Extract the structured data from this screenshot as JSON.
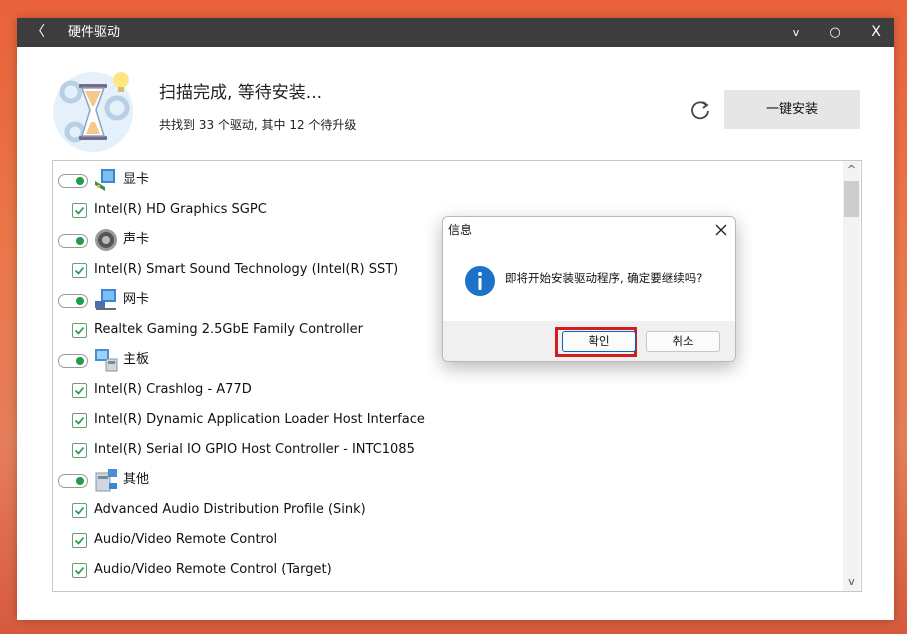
{
  "window": {
    "back_label": "〈",
    "title": "硬件驱动",
    "minimize_label": "v",
    "maximize_label": "○",
    "close_label": "X"
  },
  "header": {
    "status_title": "扫描完成, 等待安装...",
    "status_detail": "共找到 33 个驱动, 其中 12 个待升级",
    "install_button": "一键安装"
  },
  "driver_list": {
    "rows": [
      {
        "type": "category",
        "label": "显卡",
        "icon": "display-card-icon",
        "enabled": true
      },
      {
        "type": "driver",
        "label": "Intel(R) HD Graphics SGPC",
        "checked": true
      },
      {
        "type": "category",
        "label": "声卡",
        "icon": "speaker-icon",
        "enabled": true
      },
      {
        "type": "driver",
        "label": "Intel(R) Smart Sound Technology (Intel(R) SST)",
        "checked": true
      },
      {
        "type": "category",
        "label": "网卡",
        "icon": "network-icon",
        "enabled": true
      },
      {
        "type": "driver",
        "label": "Realtek Gaming 2.5GbE Family Controller",
        "checked": true
      },
      {
        "type": "category",
        "label": "主板",
        "icon": "motherboard-icon",
        "enabled": true
      },
      {
        "type": "driver",
        "label": "Intel(R) Crashlog - A77D",
        "checked": true
      },
      {
        "type": "driver",
        "label": "Intel(R) Dynamic Application Loader Host Interface",
        "checked": true
      },
      {
        "type": "driver",
        "label": "Intel(R) Serial IO GPIO Host Controller - INTC1085",
        "checked": true
      },
      {
        "type": "category",
        "label": "其他",
        "icon": "other-device-icon",
        "enabled": true
      },
      {
        "type": "driver",
        "label": "Advanced Audio Distribution Profile (Sink)",
        "checked": true
      },
      {
        "type": "driver",
        "label": "Audio/Video Remote Control",
        "checked": true
      },
      {
        "type": "driver",
        "label": "Audio/Video Remote Control (Target)",
        "checked": true
      }
    ],
    "scroll_up": "^",
    "scroll_down": "v"
  },
  "dialog": {
    "title": "信息",
    "message": "即将开始安装驱动程序, 确定要继续吗?",
    "ok_button": "확인",
    "cancel_button": "취소",
    "icon": "info-icon",
    "highlight_color": "#d61d1d"
  },
  "colors": {
    "titlebar": "#3d3d3d",
    "toggle_on": "#1f9e4a",
    "info_blue": "#1a73c8"
  }
}
